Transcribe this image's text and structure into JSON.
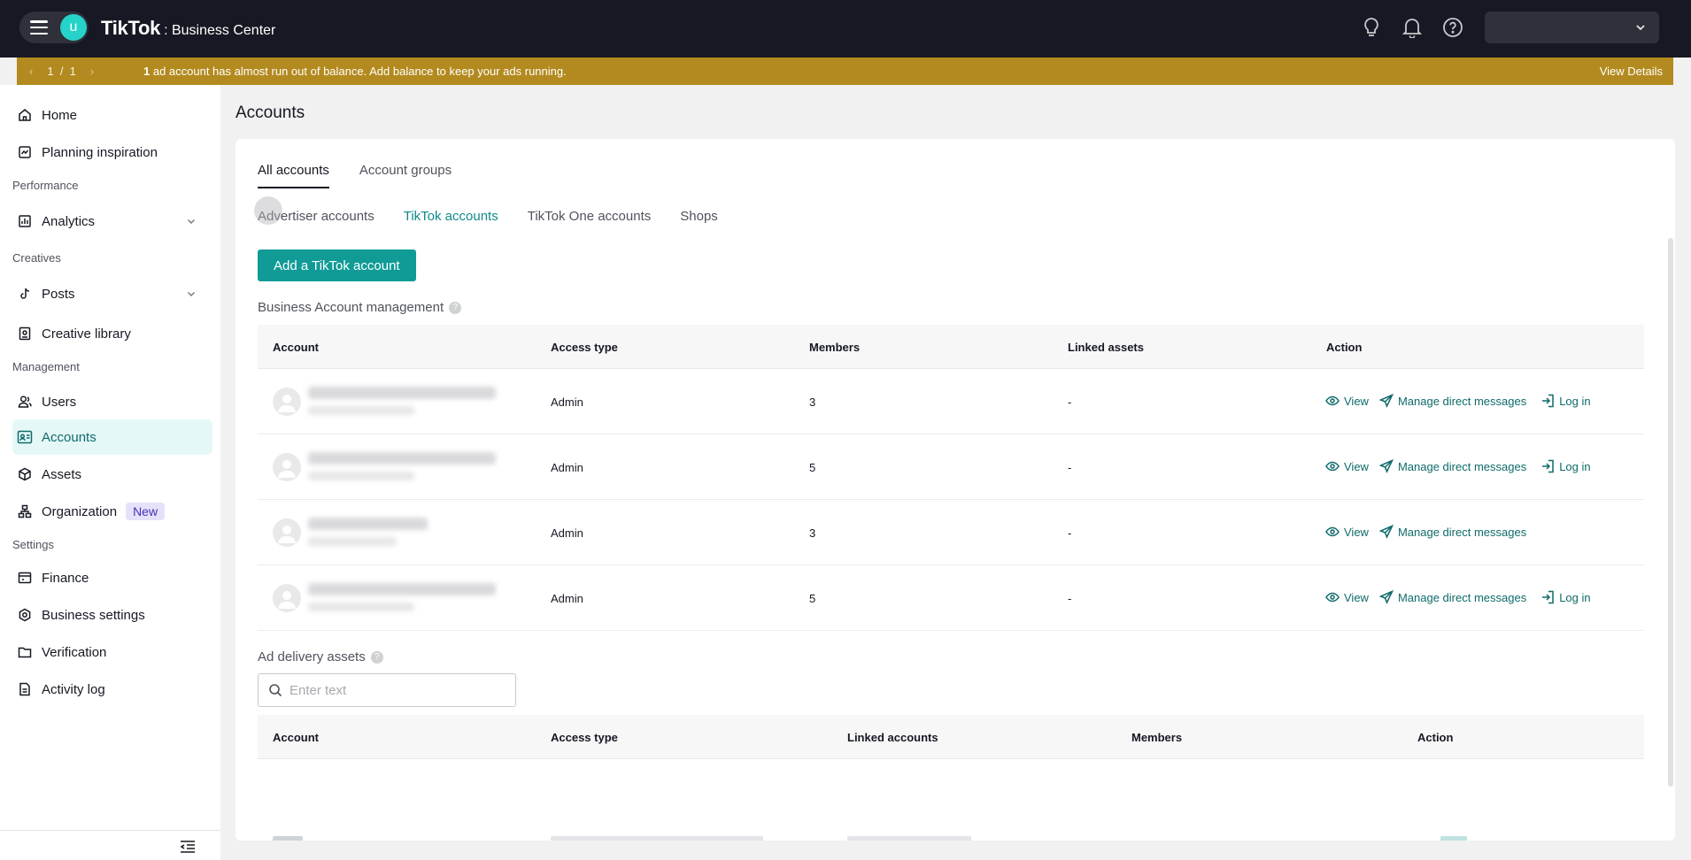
{
  "header": {
    "brand": "TikTok",
    "brand_suffix": ": Business Center",
    "avatar_letter": "u"
  },
  "notice": {
    "page": "1",
    "separator": "/",
    "total": "1",
    "count": "1",
    "message": " ad account has almost run out of balance. Add balance to keep your ads running.",
    "action": "View Details"
  },
  "sidebar": {
    "home": "Home",
    "planning": "Planning inspiration",
    "performance": "Performance",
    "analytics": "Analytics",
    "creatives": "Creatives",
    "posts": "Posts",
    "creative_library": "Creative library",
    "management": "Management",
    "users": "Users",
    "accounts": "Accounts",
    "assets": "Assets",
    "organization": "Organization",
    "new_badge": "New",
    "settings": "Settings",
    "finance": "Finance",
    "business_settings": "Business settings",
    "verification": "Verification",
    "activity_log": "Activity log"
  },
  "main": {
    "title": "Accounts",
    "tabs": [
      "All accounts",
      "Account groups"
    ],
    "subtabs": [
      "Advertiser accounts",
      "TikTok accounts",
      "TikTok One accounts",
      "Shops"
    ],
    "add_button": "Add a TikTok account",
    "business_section": "Business Account management",
    "business_table": {
      "headers": [
        "Account",
        "Access type",
        "Members",
        "Linked assets",
        "Action"
      ],
      "rows": [
        {
          "access": "Admin",
          "members": "3",
          "linked": "-"
        },
        {
          "access": "Admin",
          "members": "5",
          "linked": "-"
        },
        {
          "access": "Admin",
          "members": "3",
          "linked": "-"
        },
        {
          "access": "Admin",
          "members": "5",
          "linked": "-"
        }
      ],
      "actions": {
        "view": "View",
        "manage": "Manage direct messages",
        "login": "Log in"
      }
    },
    "ad_section": "Ad delivery assets",
    "search_placeholder": "Enter text",
    "ad_table": {
      "headers": [
        "Account",
        "Access type",
        "Linked accounts",
        "Members",
        "Action"
      ]
    }
  },
  "colors": {
    "accent": "#109b96",
    "notice": "#b38a1f",
    "topbar": "#161823"
  }
}
